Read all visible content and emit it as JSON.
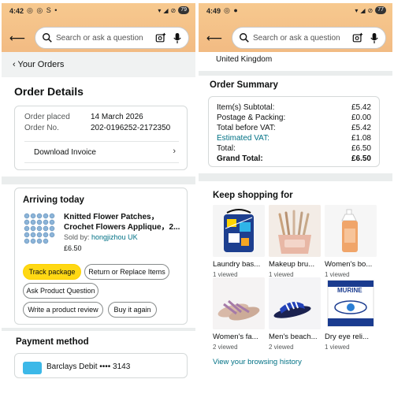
{
  "left": {
    "status": {
      "time": "4:42",
      "icons_left": "◎ ◎ S •",
      "battery": "79"
    },
    "search": {
      "placeholder": "Search or ask a question"
    },
    "breadcrumb": "‹ Your Orders",
    "order_details": {
      "title": "Order Details",
      "placed_label": "Order placed",
      "placed_value": "14 March 2026",
      "number_label": "Order No.",
      "number_value": "202-0196252-2172350",
      "download_label": "Download Invoice"
    },
    "arriving": {
      "title": "Arriving today",
      "product_title": "Knitted Flower Patches，Crochet Flowers Applique，2...",
      "sold_by_label": "Sold by: ",
      "sold_by_seller": "hongjizhou UK",
      "price": "£6.50",
      "buttons": {
        "track": "Track package",
        "return": "Return or Replace Items",
        "ask": "Ask Product Question",
        "review": "Write a product review",
        "buy_again": "Buy it again"
      }
    },
    "payment": {
      "title": "Payment method",
      "card_text": "Barclays Debit •••• 3143"
    }
  },
  "right": {
    "status": {
      "time": "4:49",
      "icons_left": "◎ ●",
      "battery": "77"
    },
    "search": {
      "placeholder": "Search or ask a question"
    },
    "address_tail": "United Kingdom",
    "summary": {
      "title": "Order Summary",
      "rows": [
        {
          "label": "Item(s) Subtotal:",
          "value": "£5.42"
        },
        {
          "label": "Postage & Packing:",
          "value": "£0.00"
        },
        {
          "label": "Total before VAT:",
          "value": "£5.42"
        },
        {
          "label": "Estimated VAT:",
          "value": "£1.08"
        },
        {
          "label": "Total:",
          "value": "£6.50"
        },
        {
          "label": "Grand Total:",
          "value": "£6.50"
        }
      ]
    },
    "keep_shopping": {
      "title": "Keep shopping for",
      "tiles": [
        {
          "title": "Laundry bas...",
          "meta": "1 viewed"
        },
        {
          "title": "Makeup bru...",
          "meta": "1 viewed"
        },
        {
          "title": "Women's bo...",
          "meta": "1 viewed"
        },
        {
          "title": "Women's fa...",
          "meta": "2 viewed"
        },
        {
          "title": "Men's beach...",
          "meta": "2 viewed"
        },
        {
          "title": "Dry eye reli...",
          "meta": "1 viewed"
        }
      ],
      "eye_product_brand": "MURINE",
      "history_link": "View your browsing history"
    }
  },
  "colors": {
    "header": "#f2bb83",
    "accent_link": "#007185",
    "primary_button": "#ffd814",
    "card_icon": "#3cb8e8"
  }
}
